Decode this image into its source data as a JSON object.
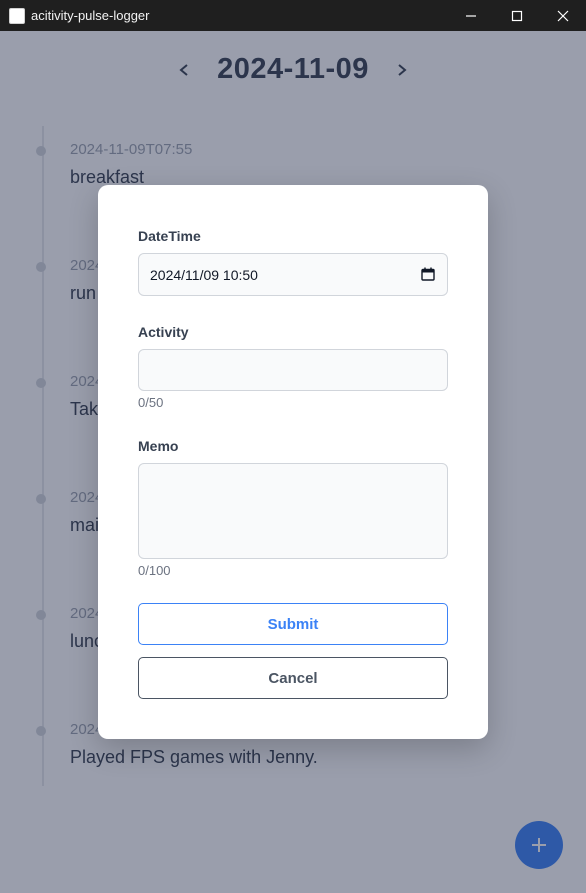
{
  "window": {
    "title": "acitivity-pulse-logger"
  },
  "header": {
    "date": "2024-11-09",
    "prev_icon": "chevron-left-icon",
    "next_icon": "chevron-right-icon"
  },
  "timeline": {
    "entries": [
      {
        "time": "2024-11-09T07:55",
        "activity": "breakfast"
      },
      {
        "time": "2024-",
        "activity": "run"
      },
      {
        "time": "2024-",
        "activity": "Tak"
      },
      {
        "time": "2024-",
        "activity": "mai"
      },
      {
        "time": "2024-",
        "activity": "lunc"
      },
      {
        "time": "2024-",
        "activity": "Played FPS games with Jenny."
      }
    ]
  },
  "fab": {
    "icon": "plus-icon"
  },
  "form": {
    "datetime_label": "DateTime",
    "datetime_value": "2024/11/09 10:50",
    "activity_label": "Activity",
    "activity_value": "",
    "activity_counter": "0/50",
    "memo_label": "Memo",
    "memo_value": "",
    "memo_counter": "0/100",
    "submit_label": "Submit",
    "cancel_label": "Cancel"
  },
  "colors": {
    "accent": "#3b82f6",
    "text": "#374151",
    "muted": "#9ca3af"
  }
}
